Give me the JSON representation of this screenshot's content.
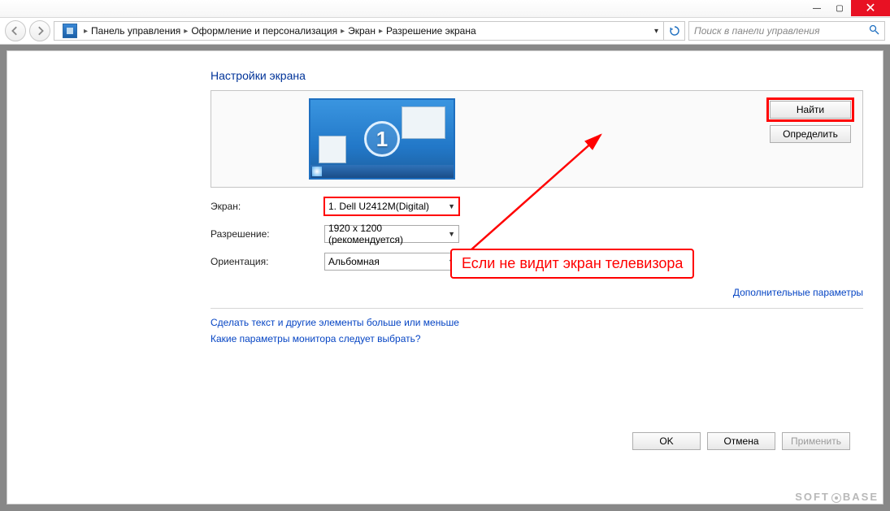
{
  "titlebar": {
    "close_glyph": "✕",
    "min_glyph": "—",
    "max_glyph": "▢"
  },
  "breadcrumb": {
    "items": [
      "Панель управления",
      "Оформление и персонализация",
      "Экран",
      "Разрешение экрана"
    ]
  },
  "search": {
    "placeholder": "Поиск в панели управления"
  },
  "page": {
    "title": "Настройки экрана",
    "monitor_number": "1",
    "find_btn": "Найти",
    "detect_btn": "Определить",
    "labels": {
      "screen": "Экран:",
      "resolution": "Разрешение:",
      "orientation": "Ориентация:"
    },
    "values": {
      "screen": "1. Dell U2412M(Digital)",
      "resolution": "1920 x 1200 (рекомендуется)",
      "orientation": "Альбомная"
    },
    "advanced_link": "Дополнительные параметры",
    "link1": "Сделать текст и другие элементы больше или меньше",
    "link2": "Какие параметры монитора следует выбрать?",
    "ok": "OK",
    "cancel": "Отмена",
    "apply": "Применить"
  },
  "annotation": {
    "text": "Если не видит экран телевизора"
  },
  "watermark": {
    "left": "SOFT",
    "right": "BASE"
  }
}
